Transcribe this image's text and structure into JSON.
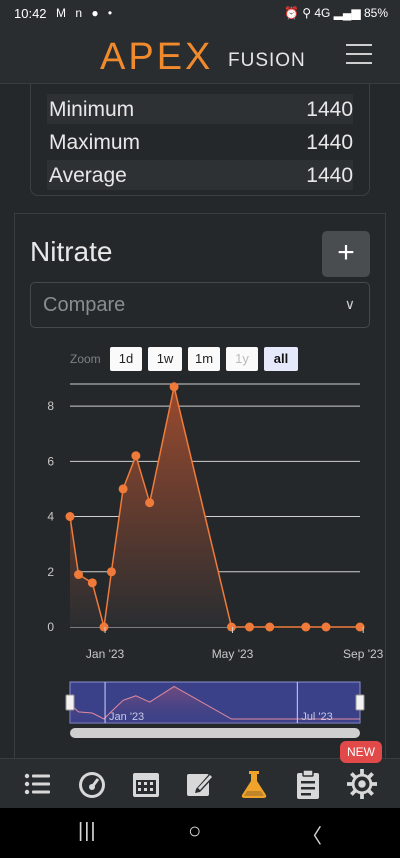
{
  "status_bar": {
    "time": "10:42",
    "left_icons": "M n ● •",
    "right_text": "⏰ ⚲ 4G ▂▄▆ 85%"
  },
  "app": {
    "logo_main": "APEX",
    "logo_sub": "FUSION"
  },
  "stats": [
    {
      "label": "Minimum",
      "value": "1440"
    },
    {
      "label": "Maximum",
      "value": "1440"
    },
    {
      "label": "Average",
      "value": "1440"
    }
  ],
  "section": {
    "title": "Nitrate",
    "add_label": "+",
    "compare_placeholder": "Compare"
  },
  "zoom": {
    "label": "Zoom",
    "buttons": [
      {
        "label": "1d",
        "state": "normal"
      },
      {
        "label": "1w",
        "state": "normal"
      },
      {
        "label": "1m",
        "state": "normal"
      },
      {
        "label": "1y",
        "state": "disabled"
      },
      {
        "label": "all",
        "state": "active"
      }
    ]
  },
  "chart_data": {
    "type": "area",
    "ylim": [
      0,
      8.8
    ],
    "y_ticks": [
      0,
      2,
      4,
      6,
      8
    ],
    "x_tick_labels": [
      "Jan '23",
      "May '23",
      "Sep '23"
    ],
    "x_tick_dates": [
      "2023-01-01",
      "2023-05-01",
      "2023-09-01"
    ],
    "x": [
      "2022-11-29",
      "2022-12-07",
      "2022-12-20",
      "2022-12-31",
      "2023-01-07",
      "2023-01-18",
      "2023-01-30",
      "2023-02-12",
      "2023-03-07",
      "2023-04-30",
      "2023-05-17",
      "2023-06-05",
      "2023-07-09",
      "2023-07-28",
      "2023-08-29"
    ],
    "values": [
      4.0,
      1.9,
      1.6,
      0.0,
      2.0,
      5.0,
      6.2,
      4.5,
      8.7,
      0.0,
      0.0,
      0.0,
      0.0,
      0.0,
      0.0
    ],
    "colors": {
      "line": "#f07a3a",
      "point": "#f07a3a",
      "fill_top": "#9a4a2e",
      "fill_bottom": "#2a2d30",
      "grid": "#cfcfcf",
      "axis_text": "#c8c8c8"
    },
    "navigator": {
      "labels": [
        "Jan '23",
        "Jul '23"
      ],
      "label_dates": [
        "2023-01-01",
        "2023-07-01"
      ],
      "background": "#3b4188",
      "line": "#e08aa0"
    }
  },
  "bottom_nav": {
    "items": [
      {
        "name": "list-icon",
        "glyph": "☰"
      },
      {
        "name": "dashboard-gauge-icon",
        "glyph": "◔"
      },
      {
        "name": "calendar-icon",
        "glyph": "▦"
      },
      {
        "name": "edit-note-icon",
        "glyph": "✎"
      },
      {
        "name": "flask-icon",
        "glyph": "⚗"
      },
      {
        "name": "clipboard-icon",
        "glyph": "▤"
      },
      {
        "name": "settings-gear-icon",
        "glyph": "⚙"
      }
    ],
    "active_color": "#f0a32a",
    "badge": "NEW"
  },
  "system_nav": {
    "recent": "|||",
    "home": "○",
    "back": "〈"
  }
}
